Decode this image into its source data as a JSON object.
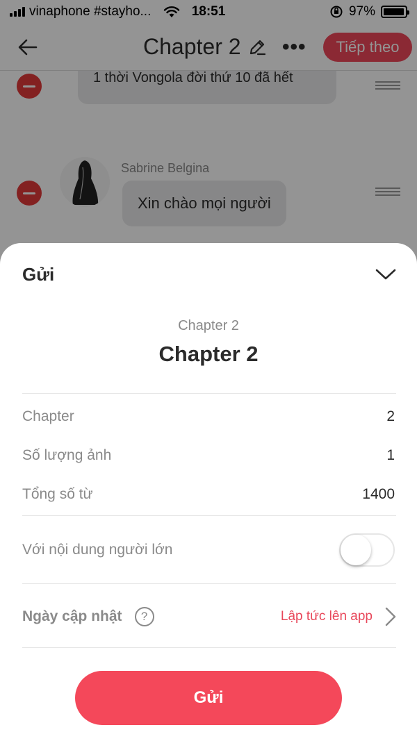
{
  "status_bar": {
    "carrier": "vinaphone #stayho...",
    "time": "18:51",
    "battery_percent": "97%",
    "battery_level": 0.97
  },
  "nav": {
    "title": "Chapter 2",
    "next_label": "Tiếp theo"
  },
  "editor": {
    "message_1": "1 thời Vongola đời thứ 10 đã hết",
    "character_name": "Sabrine Belgina",
    "message_2": "Xin chào mọi người"
  },
  "sheet": {
    "title": "Gửi",
    "chapter_subtitle": "Chapter 2",
    "chapter_title": "Chapter 2",
    "rows": [
      {
        "label": "Chapter",
        "value": "2"
      },
      {
        "label": "Số lượng ảnh",
        "value": "1"
      },
      {
        "label": "Tổng số từ",
        "value": "1400"
      }
    ],
    "adult_label": "Với nội dung người lớn",
    "adult_enabled": false,
    "date_label": "Ngày cập nhật",
    "help_glyph": "?",
    "date_value": "Lập tức lên app",
    "send_label": "Gửi"
  },
  "colors": {
    "accent": "#f4485a",
    "remove": "#e23a3a",
    "muted_text": "#8a8a8a"
  },
  "icons": [
    "signal-icon",
    "wifi-icon",
    "orientation-lock-icon",
    "battery-icon",
    "back-arrow-icon",
    "pencil-icon",
    "more-icon",
    "minus-icon",
    "drag-handle-icon",
    "chevron-down-icon",
    "help-icon",
    "chevron-right-icon"
  ]
}
